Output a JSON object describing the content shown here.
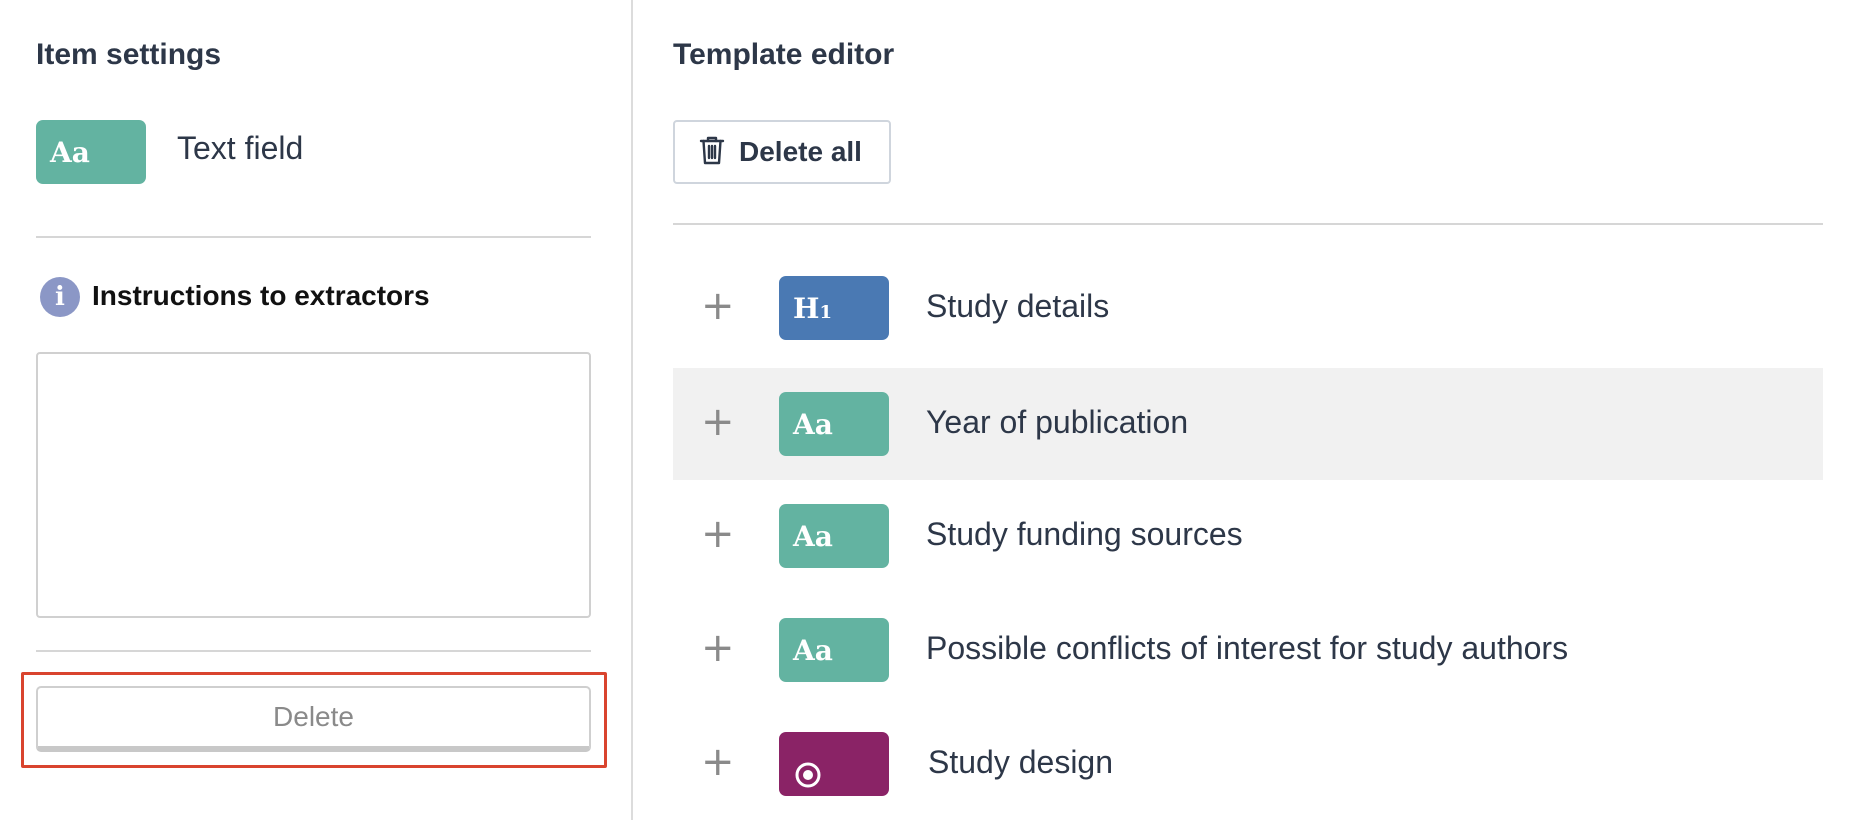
{
  "item_settings": {
    "title": "Item settings",
    "type_badge_text": "Aa",
    "type_label": "Text field",
    "instructions_label": "Instructions to extractors",
    "instructions_value": "",
    "delete_label": "Delete"
  },
  "template_editor": {
    "title": "Template editor",
    "delete_all_label": "Delete all",
    "items": [
      {
        "type": "heading",
        "badge_text": "H1",
        "label": "Study details",
        "icon": "heading-icon"
      },
      {
        "type": "text",
        "badge_text": "Aa",
        "label": "Year of publication",
        "icon": "text-field-icon"
      },
      {
        "type": "text",
        "badge_text": "Aa",
        "label": "Study funding sources",
        "icon": "text-field-icon"
      },
      {
        "type": "text",
        "badge_text": "Aa",
        "label": "Possible conflicts of interest for study authors",
        "icon": "text-field-icon"
      },
      {
        "type": "radio",
        "badge_text": "",
        "label": "Study design",
        "icon": "radio-icon"
      }
    ]
  },
  "colors": {
    "text_badge": "#63b3a1",
    "heading_badge": "#4a79b3",
    "radio_badge": "#8a2366",
    "info_icon": "#8b97c6",
    "highlight_border": "#d9442e",
    "selected_row": "#f1f1f1"
  }
}
